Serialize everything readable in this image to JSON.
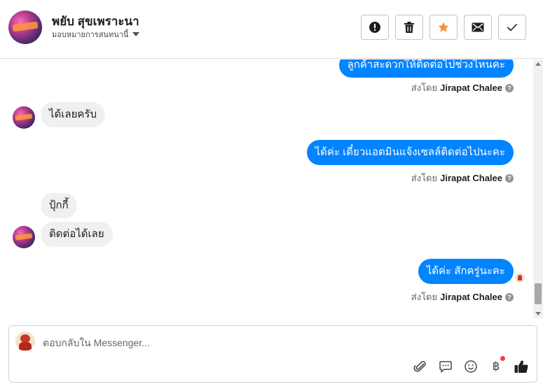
{
  "header": {
    "contact_name": "พยับ สุขเพราะนา",
    "assign_label": "มอบหมายการสนทนานี้",
    "actions": [
      {
        "name": "mark-spam-button",
        "icon": "alert-icon"
      },
      {
        "name": "delete-button",
        "icon": "trash-icon"
      },
      {
        "name": "star-button",
        "icon": "star-icon",
        "color": "#f7923b"
      },
      {
        "name": "mark-unread-button",
        "icon": "envelope-icon"
      },
      {
        "name": "mark-done-button",
        "icon": "check-icon"
      }
    ]
  },
  "thread": {
    "messages": [
      {
        "direction": "out",
        "text": "ลูกค้าสะดวกให้ติดต่อไปช่วงไหนคะ",
        "sent_by_prefix": "ส่งโดย",
        "sent_by_name": "Jirapat Chalee"
      },
      {
        "direction": "in",
        "text": "ได้เลยครับ"
      },
      {
        "direction": "out",
        "text": "ได้ค่ะ เดี๋ยวแอดมินแจ้งเซลล์ติดต่อไปนะคะ",
        "sent_by_prefix": "ส่งโดย",
        "sent_by_name": "Jirapat Chalee"
      },
      {
        "direction": "in",
        "text": "ปุ้กกี้"
      },
      {
        "direction": "in",
        "text": "ติดต่อได้เลย"
      },
      {
        "direction": "out",
        "text": "ได้ค่ะ สักครู่นะคะ",
        "sent_by_prefix": "ส่งโดย",
        "sent_by_name": "Jirapat Chalee"
      }
    ],
    "help_glyph": "?"
  },
  "composer": {
    "placeholder": "ตอบกลับใน Messenger...",
    "value": "",
    "tools": [
      {
        "name": "attach-button",
        "icon": "paperclip-icon"
      },
      {
        "name": "saved-replies-button",
        "icon": "chat-bubble-icon"
      },
      {
        "name": "emoji-button",
        "icon": "smiley-icon"
      },
      {
        "name": "payment-button",
        "icon": "baht-icon",
        "glyph": "฿",
        "badge": true
      },
      {
        "name": "like-button",
        "icon": "thumbs-up-icon"
      }
    ]
  },
  "colors": {
    "outgoing_bubble": "#0084ff",
    "incoming_bubble": "#f0f0f0",
    "star": "#f7923b",
    "notification_dot": "#fa3e3e"
  }
}
